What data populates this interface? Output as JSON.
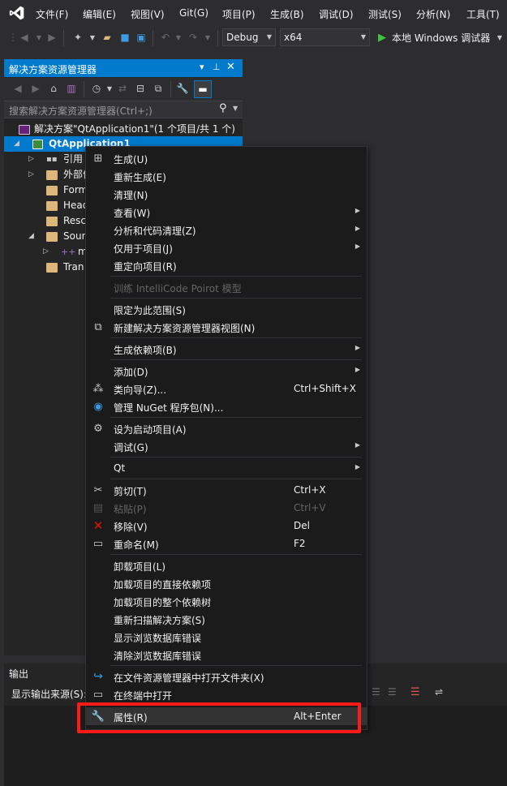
{
  "menubar": {
    "items": [
      "文件(F)",
      "编辑(E)",
      "视图(V)",
      "Git(G)",
      "项目(P)",
      "生成(B)",
      "调试(D)",
      "测试(S)",
      "分析(N)",
      "工具(T)"
    ]
  },
  "toolbar": {
    "config": "Debug",
    "platform": "x64",
    "run_label": "本地 Windows 调试器"
  },
  "solution_explorer": {
    "title": "解决方案资源管理器",
    "search_placeholder": "搜索解决方案资源管理器(Ctrl+;)",
    "solution_label": "解决方案\"QtApplication1\"(1 个项目/共 1 个)",
    "project_label": "QtApplication1",
    "nodes": [
      "引用",
      "外部依",
      "Form",
      "Head",
      "Resc",
      "Sour",
      "m",
      "Tran"
    ]
  },
  "output": {
    "title": "输出",
    "source_label": "显示输出来源(S):"
  },
  "context_menu": {
    "items": [
      {
        "label": "生成(U)",
        "shortcut": ""
      },
      {
        "label": "重新生成(E)",
        "shortcut": ""
      },
      {
        "label": "清理(N)",
        "shortcut": ""
      },
      {
        "label": "查看(W)",
        "shortcut": ""
      },
      {
        "label": "分析和代码清理(Z)",
        "shortcut": ""
      },
      {
        "label": "仅用于项目(J)",
        "shortcut": ""
      },
      {
        "label": "重定向项目(R)",
        "shortcut": ""
      },
      {
        "label": "训练 IntelliCode Poirot 模型",
        "shortcut": ""
      },
      {
        "label": "限定为此范围(S)",
        "shortcut": ""
      },
      {
        "label": "新建解决方案资源管理器视图(N)",
        "shortcut": ""
      },
      {
        "label": "生成依赖项(B)",
        "shortcut": ""
      },
      {
        "label": "添加(D)",
        "shortcut": ""
      },
      {
        "label": "类向导(Z)...",
        "shortcut": "Ctrl+Shift+X"
      },
      {
        "label": "管理 NuGet 程序包(N)...",
        "shortcut": ""
      },
      {
        "label": "设为启动项目(A)",
        "shortcut": ""
      },
      {
        "label": "调试(G)",
        "shortcut": ""
      },
      {
        "label": "Qt",
        "shortcut": ""
      },
      {
        "label": "剪切(T)",
        "shortcut": "Ctrl+X"
      },
      {
        "label": "粘贴(P)",
        "shortcut": "Ctrl+V"
      },
      {
        "label": "移除(V)",
        "shortcut": "Del"
      },
      {
        "label": "重命名(M)",
        "shortcut": "F2"
      },
      {
        "label": "卸载项目(L)",
        "shortcut": ""
      },
      {
        "label": "加载项目的直接依赖项",
        "shortcut": ""
      },
      {
        "label": "加载项目的整个依赖树",
        "shortcut": ""
      },
      {
        "label": "重新扫描解决方案(S)",
        "shortcut": ""
      },
      {
        "label": "显示浏览数据库错误",
        "shortcut": ""
      },
      {
        "label": "清除浏览数据库错误",
        "shortcut": ""
      },
      {
        "label": "在文件资源管理器中打开文件夹(X)",
        "shortcut": ""
      },
      {
        "label": "在终端中打开",
        "shortcut": ""
      },
      {
        "label": "属性(R)",
        "shortcut": "Alt+Enter"
      }
    ]
  },
  "colors": {
    "accent": "#007acc",
    "highlight_border": "#ff1a1a",
    "run_green": "#3fc43f"
  }
}
